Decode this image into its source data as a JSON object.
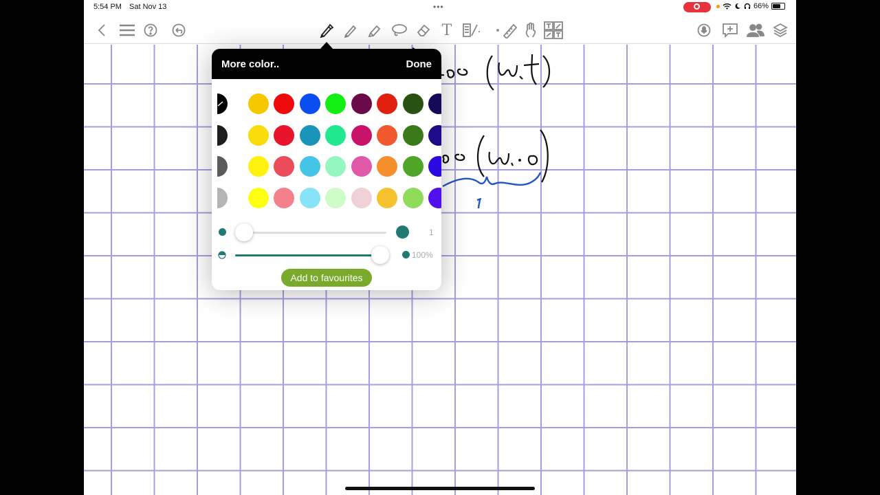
{
  "status": {
    "time": "5:54 PM",
    "date": "Sat Nov 13",
    "battery": "66%",
    "battery_level": 0.66
  },
  "toolbar": {
    "left_icons": [
      "back-chevron-icon",
      "menu-icon",
      "help-icon",
      "undo-icon"
    ],
    "center_icons": [
      "fountain-pen-icon",
      "pencil-icon",
      "highlighter-icon",
      "lasso-icon",
      "eraser-icon",
      "text-icon",
      "shapes-icon",
      "ruler-icon",
      "hand-icon",
      "stickers-icon"
    ],
    "right_icons": [
      "microphone-icon",
      "add-comment-icon",
      "collaborators-icon",
      "layers-icon"
    ],
    "text_tool_label": "T"
  },
  "popover": {
    "title": "More color..",
    "done": "Done",
    "swatch_rows": [
      [
        "#000000",
        "#f5c800",
        "#ee0a0a",
        "#0a4ef2",
        "#12ee12",
        "#6a0a49",
        "#e0200f",
        "#285214",
        "#130a59"
      ],
      [
        "#1e1e1e",
        "#f8dc0c",
        "#e8142c",
        "#1895b8",
        "#22e890",
        "#c8126c",
        "#f05a2e",
        "#3a7a18",
        "#1c0a86"
      ],
      [
        "#5a5a5a",
        "#fff20e",
        "#ec4b5a",
        "#45c5e8",
        "#96f6c2",
        "#e058a8",
        "#f5902c",
        "#4ea528",
        "#2a0ae0"
      ],
      [
        "#b4b4b4",
        "#ffff12",
        "#f4808c",
        "#86e4f6",
        "#cefcc8",
        "#f0d2d6",
        "#f5c22e",
        "#8edc5a",
        "#5010f0"
      ]
    ],
    "size_value": "1",
    "size_level": 0.0,
    "opacity_value": "100%",
    "opacity_level": 1.0,
    "slider_color": "#1e7a72",
    "add_favourites": "Add to favourites"
  },
  "colors": {
    "grid_line": "#a79ce0",
    "ink": "#111111",
    "brace": "#1f55c4"
  }
}
